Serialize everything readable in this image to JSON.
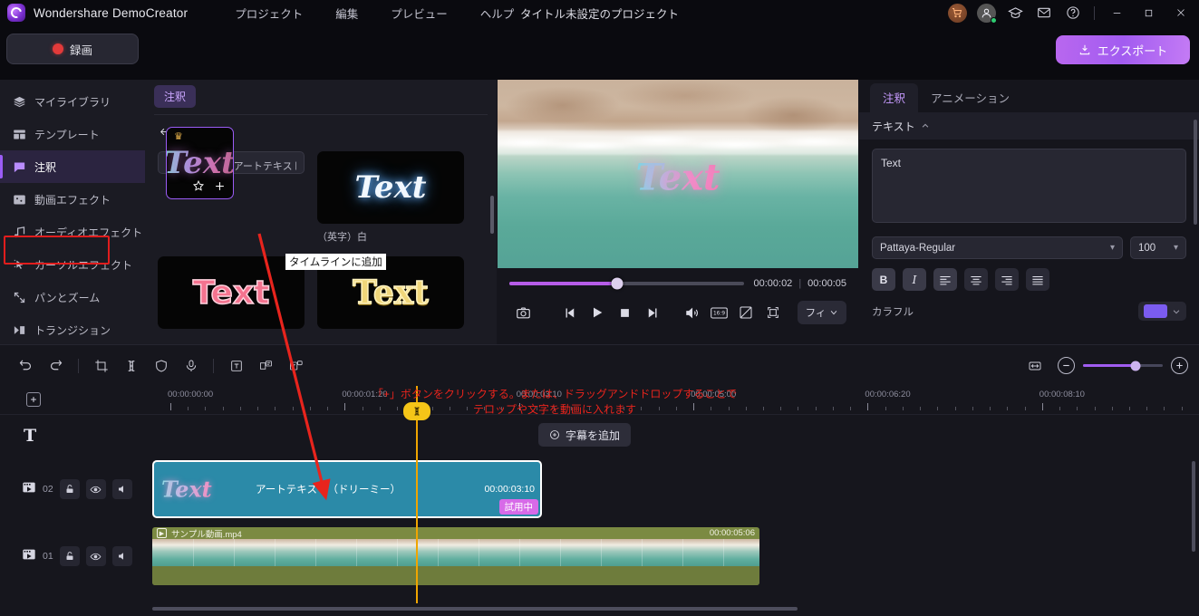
{
  "app": {
    "name": "Wondershare DemoCreator",
    "project_title": "タイトル未設定のプロジェクト",
    "menus": [
      "プロジェクト",
      "編集",
      "プレビュー",
      "ヘルプ"
    ]
  },
  "toolbar": {
    "record_label": "録画",
    "export_label": "エクスポート",
    "icons": [
      "cart-icon",
      "account-icon",
      "graduation-cap-icon",
      "mail-icon",
      "help-icon"
    ],
    "window_buttons": [
      "minimize",
      "maximize",
      "close"
    ]
  },
  "sidebar": {
    "items": [
      {
        "label": "マイライブラリ",
        "icon": "layers-icon",
        "active": false
      },
      {
        "label": "テンプレート",
        "icon": "template-icon",
        "active": false
      },
      {
        "label": "注釈",
        "icon": "annotation-icon",
        "active": true
      },
      {
        "label": "動画エフェクト",
        "icon": "video-effect-icon",
        "active": false
      },
      {
        "label": "オーディオエフェクト",
        "icon": "audio-effect-icon",
        "active": false
      },
      {
        "label": "カーソルエフェクト",
        "icon": "cursor-effect-icon",
        "active": false
      },
      {
        "label": "パンとズーム",
        "icon": "pan-zoom-icon",
        "active": false
      },
      {
        "label": "トランジション",
        "icon": "transition-icon",
        "active": false
      }
    ]
  },
  "templates": {
    "tab_label": "注釈",
    "back_label": "戻る",
    "tooltip": "タイムラインに追加",
    "items": [
      {
        "label": "アートテキスト（ドリーミー）",
        "style": "dreamy",
        "crown": true,
        "selected": true
      },
      {
        "label": "（英字）白",
        "style": "white-glow",
        "crown": false,
        "selected": false
      },
      {
        "label": "",
        "style": "pink",
        "crown": false,
        "selected": false
      },
      {
        "label": "",
        "style": "gold",
        "crown": true,
        "selected": false
      }
    ]
  },
  "preview": {
    "overlay_text": "Text",
    "current_time": "00:00:02",
    "total_time": "00:00:05",
    "progress_percent": 46,
    "controls": [
      "snapshot-icon",
      "prev-frame-icon",
      "play-icon",
      "stop-icon",
      "next-frame-icon",
      "volume-icon",
      "aspect-ratio-icon",
      "crop-icon",
      "fullscreen-icon"
    ],
    "aspect_label": "16:9",
    "fit_label": "フィ"
  },
  "properties": {
    "tabs": [
      {
        "label": "注釈",
        "active": true
      },
      {
        "label": "アニメーション",
        "active": false
      }
    ],
    "section_label": "テキスト",
    "text_value": "Text",
    "font_family": "Pattaya-Regular",
    "font_size": "100",
    "format_buttons": [
      "bold",
      "italic",
      "align-left",
      "align-center",
      "align-right",
      "align-justify"
    ],
    "bold_label": "B",
    "italic_label": "I",
    "color_label": "カラフル",
    "color_value": "#7b5cf0"
  },
  "timeline": {
    "tools": [
      "undo-icon",
      "redo-icon",
      "crop-icon",
      "split-icon",
      "shield-icon",
      "microphone-icon",
      "text-icon",
      "subtitle-icon",
      "caption-icon"
    ],
    "zoom_icons": [
      "fit-timeline-icon",
      "zoom-out-icon",
      "zoom-in-icon"
    ],
    "zoom_percent": 66,
    "add_track_label": "+",
    "subtitle_button": "字幕を追加",
    "text_track_glyph": "T",
    "ruler_labels": [
      "00:00:00:00",
      "00:00:01:20",
      "00:00:03:10",
      "00:00:05:00",
      "00:00:06:20",
      "00:00:08:10"
    ],
    "tracks": [
      {
        "number": "02",
        "icon": "film-icon",
        "buttons": [
          "lock-icon",
          "eye-icon",
          "mute-icon"
        ]
      },
      {
        "number": "01",
        "icon": "film-icon",
        "buttons": [
          "lock-icon",
          "eye-icon",
          "mute-icon"
        ]
      }
    ],
    "text_clip": {
      "name": "アートテキスト（ドリーミー）",
      "duration": "00:00:03:10",
      "badge": "試用中",
      "thumb_text": "Text"
    },
    "video_clip": {
      "name": "サンプル動画.mp4",
      "duration": "00:00:05:06"
    }
  },
  "annotation": {
    "line1": "「+」ボタンをクリックする。または、ドラッグアンドドロップすることで",
    "line2": "テロップや文字を動画に入れます",
    "color": "#e8241d"
  }
}
